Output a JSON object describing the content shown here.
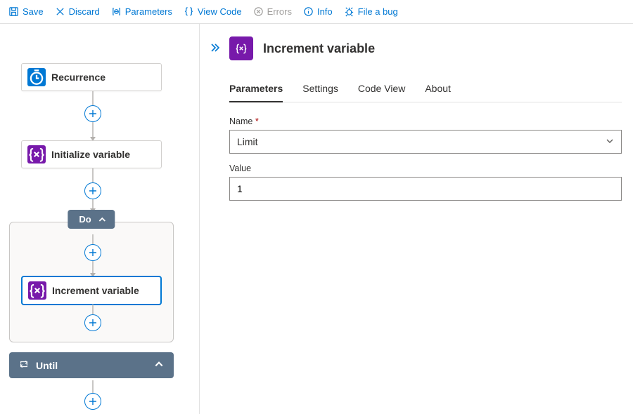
{
  "toolbar": {
    "save": "Save",
    "discard": "Discard",
    "parameters": "Parameters",
    "view_code": "View Code",
    "errors": "Errors",
    "info": "Info",
    "file_bug": "File a bug"
  },
  "canvas": {
    "recurrence": "Recurrence",
    "initialize": "Initialize variable",
    "do_label": "Do",
    "increment": "Increment variable",
    "until_label": "Until"
  },
  "panel": {
    "title": "Increment variable",
    "tabs": {
      "parameters": "Parameters",
      "settings": "Settings",
      "code_view": "Code View",
      "about": "About"
    },
    "fields": {
      "name_label": "Name",
      "name_required": "*",
      "name_value": "Limit",
      "value_label": "Value",
      "value_value": "1"
    }
  }
}
